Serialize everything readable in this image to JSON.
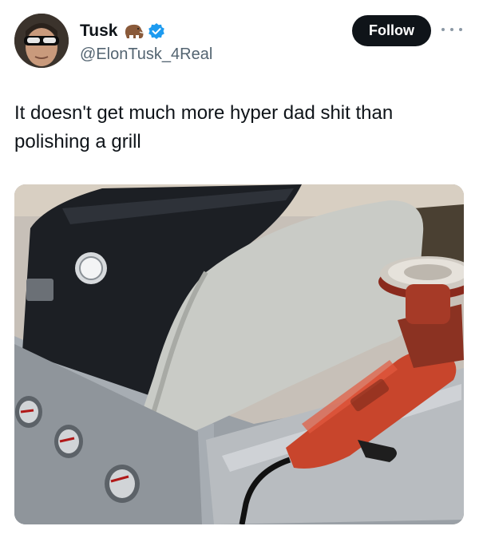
{
  "tweet": {
    "display_name": "Tusk",
    "handle": "@ElonTusk_4Real",
    "follow_label": "Follow",
    "text": "It doesn't get much more hyper dad shit than polishing a grill"
  },
  "icons": {
    "badge_emoji": "mammoth-icon",
    "verified": "verified-badge-icon",
    "more": "more-options-icon"
  },
  "media": {
    "description_alt": "Photo of a stainless steel grill with a red rotary polisher resting on the side shelf"
  },
  "colors": {
    "follow_bg": "#0f1419",
    "verified": "#1d9bf0",
    "handle": "#536471",
    "polisher_red": "#c8452c"
  }
}
